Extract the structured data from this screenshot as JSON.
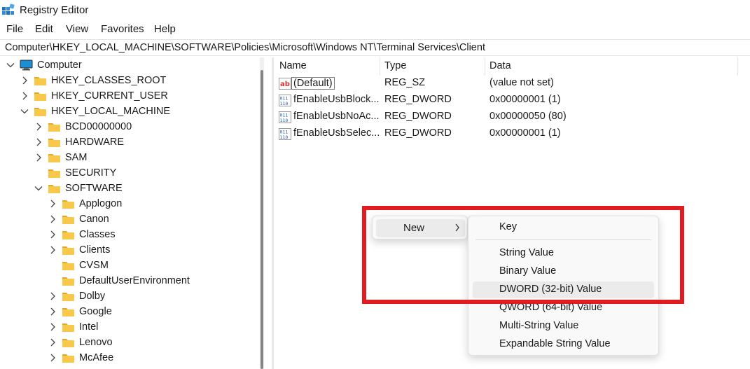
{
  "window": {
    "title": "Registry Editor",
    "app_icon": "registry-editor-icon"
  },
  "menu": [
    "File",
    "Edit",
    "View",
    "Favorites",
    "Help"
  ],
  "address": "Computer\\HKEY_LOCAL_MACHINE\\SOFTWARE\\Policies\\Microsoft\\Windows NT\\Terminal Services\\Client",
  "tree": [
    {
      "label": "Computer",
      "level": 0,
      "expander": "open",
      "icon": "computer-icon"
    },
    {
      "label": "HKEY_CLASSES_ROOT",
      "level": 1,
      "expander": "closed",
      "icon": "folder-icon"
    },
    {
      "label": "HKEY_CURRENT_USER",
      "level": 1,
      "expander": "closed",
      "icon": "folder-icon"
    },
    {
      "label": "HKEY_LOCAL_MACHINE",
      "level": 1,
      "expander": "open",
      "icon": "folder-icon"
    },
    {
      "label": "BCD00000000",
      "level": 2,
      "expander": "closed",
      "icon": "folder-icon"
    },
    {
      "label": "HARDWARE",
      "level": 2,
      "expander": "closed",
      "icon": "folder-icon"
    },
    {
      "label": "SAM",
      "level": 2,
      "expander": "closed",
      "icon": "folder-icon"
    },
    {
      "label": "SECURITY",
      "level": 2,
      "expander": "none",
      "icon": "folder-icon"
    },
    {
      "label": "SOFTWARE",
      "level": 2,
      "expander": "open",
      "icon": "folder-icon"
    },
    {
      "label": "Applogon",
      "level": 3,
      "expander": "closed",
      "icon": "folder-icon"
    },
    {
      "label": "Canon",
      "level": 3,
      "expander": "closed",
      "icon": "folder-icon"
    },
    {
      "label": "Classes",
      "level": 3,
      "expander": "closed",
      "icon": "folder-icon"
    },
    {
      "label": "Clients",
      "level": 3,
      "expander": "closed",
      "icon": "folder-icon"
    },
    {
      "label": "CVSM",
      "level": 3,
      "expander": "none",
      "icon": "folder-icon"
    },
    {
      "label": "DefaultUserEnvironment",
      "level": 3,
      "expander": "none",
      "icon": "folder-icon"
    },
    {
      "label": "Dolby",
      "level": 3,
      "expander": "closed",
      "icon": "folder-icon"
    },
    {
      "label": "Google",
      "level": 3,
      "expander": "closed",
      "icon": "folder-icon"
    },
    {
      "label": "Intel",
      "level": 3,
      "expander": "closed",
      "icon": "folder-icon"
    },
    {
      "label": "Lenovo",
      "level": 3,
      "expander": "closed",
      "icon": "folder-icon"
    },
    {
      "label": "McAfee",
      "level": 3,
      "expander": "closed",
      "icon": "folder-icon"
    }
  ],
  "columns": {
    "name": "Name",
    "type": "Type",
    "data": "Data"
  },
  "values": [
    {
      "name": "(Default)",
      "type": "REG_SZ",
      "data": "(value not set)",
      "icon": "string-value-icon"
    },
    {
      "name": "fEnableUsbBlock...",
      "type": "REG_DWORD",
      "data": "0x00000001 (1)",
      "icon": "binary-value-icon"
    },
    {
      "name": "fEnableUsbNoAc...",
      "type": "REG_DWORD",
      "data": "0x00000050 (80)",
      "icon": "binary-value-icon"
    },
    {
      "name": "fEnableUsbSelec...",
      "type": "REG_DWORD",
      "data": "0x00000001 (1)",
      "icon": "binary-value-icon"
    }
  ],
  "context_menu": {
    "new_label": "New",
    "submenu": {
      "key": "Key",
      "items": [
        "String Value",
        "Binary Value",
        "DWORD (32-bit) Value",
        "QWORD (64-bit) Value",
        "Multi-String Value",
        "Expandable String Value"
      ],
      "hovered": "DWORD (32-bit) Value"
    }
  },
  "colors": {
    "highlight": "#e01b22",
    "folder": "#f8c84a",
    "folder_dark": "#e3a82b",
    "computer_screen": "#1a8fd8",
    "menu_hover": "#ebebeb"
  }
}
